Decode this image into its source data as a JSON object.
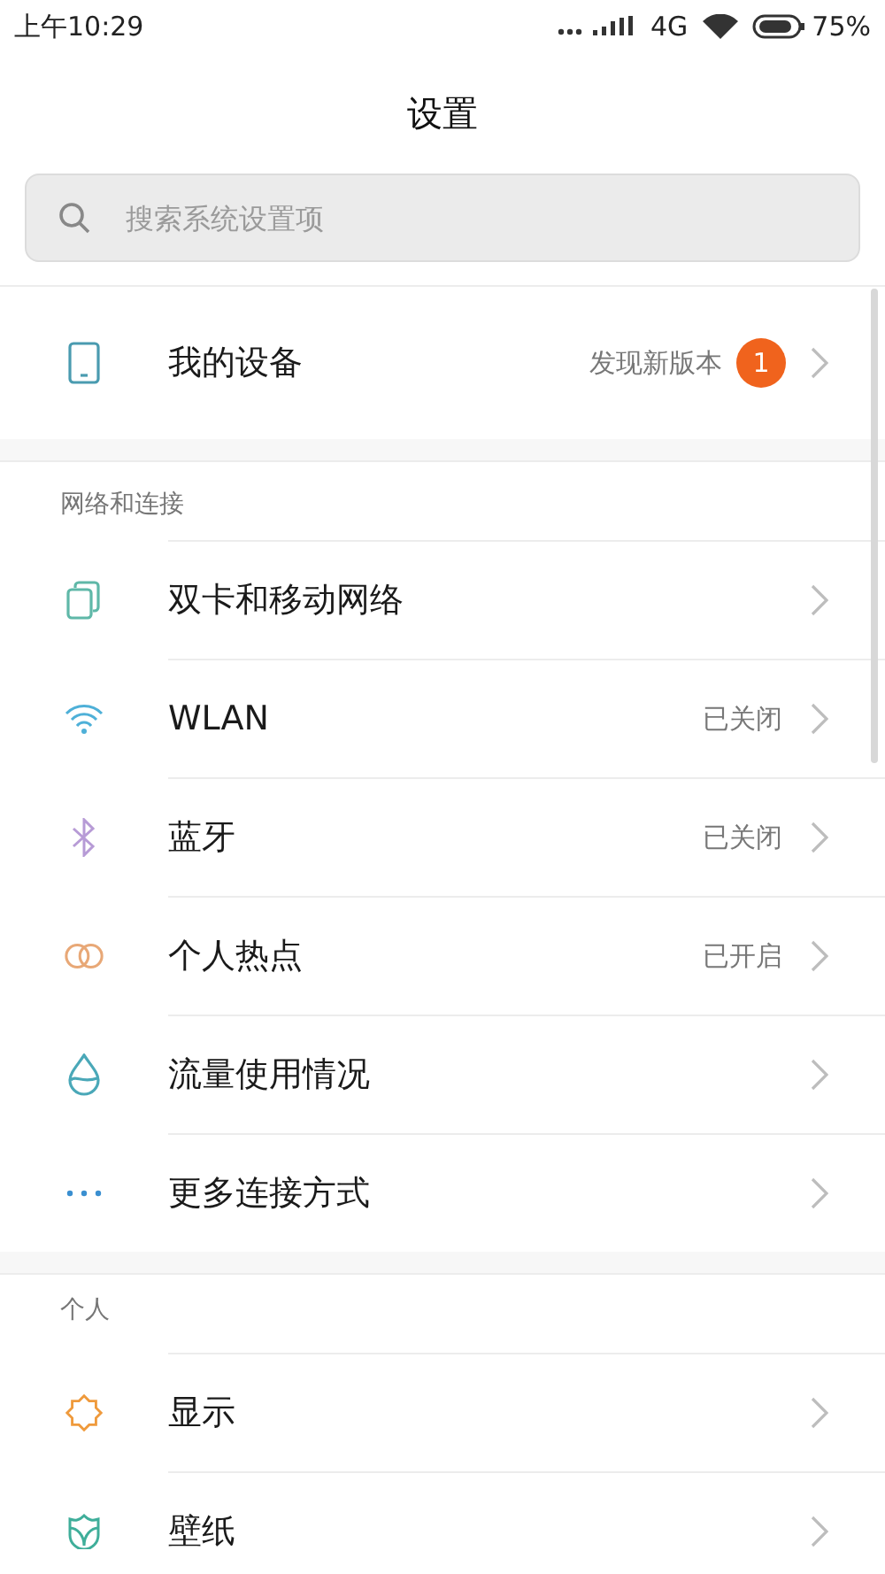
{
  "status_bar": {
    "time": "上午10:29",
    "network": "4G",
    "battery": "75%"
  },
  "title": "设置",
  "search": {
    "placeholder": "搜索系统设置项"
  },
  "device": {
    "label": "我的设备",
    "value": "发现新版本",
    "badge": "1"
  },
  "sections": [
    {
      "header": "网络和连接",
      "items": [
        {
          "kind": "sim",
          "label": "双卡和移动网络"
        },
        {
          "kind": "wifi",
          "label": "WLAN",
          "value": "已关闭"
        },
        {
          "kind": "bluetooth",
          "label": "蓝牙",
          "value": "已关闭"
        },
        {
          "kind": "hotspot",
          "label": "个人热点",
          "value": "已开启"
        },
        {
          "kind": "drop",
          "label": "流量使用情况"
        },
        {
          "kind": "dots",
          "label": "更多连接方式"
        }
      ]
    },
    {
      "header": "个人",
      "items": [
        {
          "kind": "sun",
          "label": "显示"
        },
        {
          "kind": "wallpaper",
          "label": "壁纸"
        }
      ]
    }
  ]
}
